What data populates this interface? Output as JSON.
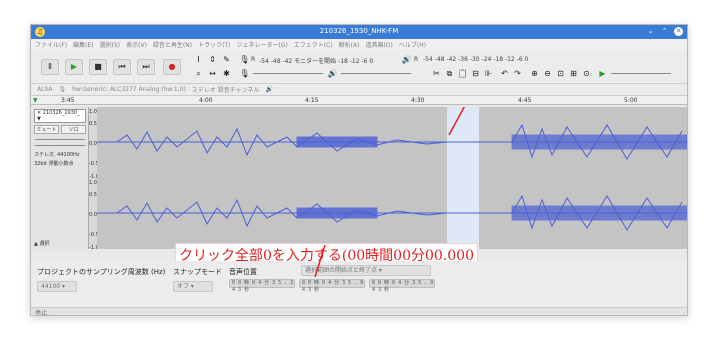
{
  "window": {
    "title": "210326_1930_NHK-FM"
  },
  "menu": [
    "ファイル(F)",
    "編集(E)",
    "選択(S)",
    "表示(V)",
    "録音と再生(N)",
    "トラック(T)",
    "ジェネレーター(G)",
    "エフェクト(C)",
    "解析(A)",
    "道具箱(O)",
    "ヘルプ(H)"
  ],
  "toolbar": {
    "pause": "Ⅱ",
    "play": "▶",
    "stop": "■",
    "skip_start": "⏮",
    "skip_end": "⏭",
    "record": "●",
    "record_meter_ticks": "-54 -48 -42 モニターを開始 -18 -12 -6 0",
    "play_meter_ticks": "-54 -48 -42 -36 -30 -24 -18 -12 -6 0",
    "rec_label": "R",
    "play_label": "R"
  },
  "devices": {
    "host": "ALSA",
    "input": "hw:Generic: ALC3277 Analog (hw:1,0)",
    "channels": "ステレオ 録音チャンネル"
  },
  "ruler": [
    "3:45",
    "4:00",
    "4:15",
    "4:30",
    "4:45",
    "5:00"
  ],
  "track": {
    "name": "210326_1930_",
    "mute": "ミュート",
    "solo": "ソロ",
    "info_1": "ステレオ, 44100Hz",
    "info_2": "32bit 浮動小数点",
    "select": "選択",
    "scale": [
      "1.0",
      "0.5-",
      "0.0-",
      "-0.5",
      "-1.0"
    ]
  },
  "annotation": "クリック全部0を入力する(00時間00分00.000秒)",
  "bottom": {
    "rate_label": "プロジェクトのサンプリング周波数 (Hz)",
    "rate_value": "44100",
    "snap_label": "スナップモード",
    "snap_value": "オフ",
    "pos_label": "音声位置",
    "sel_mode": "選択範囲の開始点と終了点",
    "time1": "0 0 時 0 4 分 3 5 . 3 4 3 秒",
    "time2": "0 0 時 0 4 分 3 5 . 9 4 3 秒",
    "time3": "0 0 時 0 4 分 3 5 . 9 4 3 秒"
  },
  "status": "停止."
}
